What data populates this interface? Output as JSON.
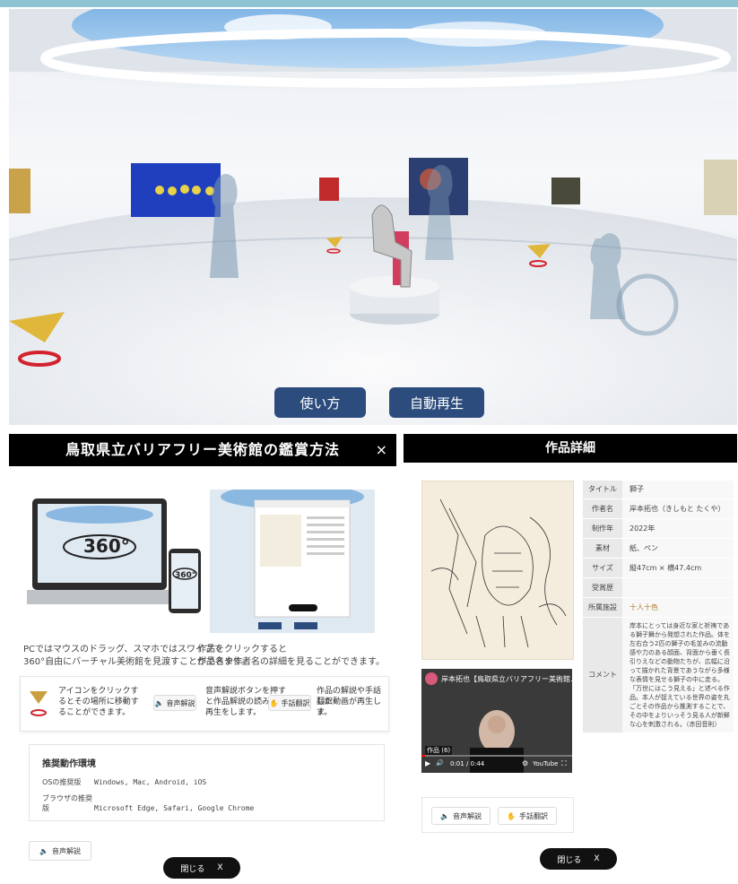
{
  "gallery": {
    "usage_button": "使い方",
    "autoplay_button": "自動再生"
  },
  "guide": {
    "title": "鳥取県立バリアフリー美術館の鑑賞方法",
    "close_icon": "×",
    "caption_left_1": "PCではマウスのドラッグ、スマホではスワイプで",
    "caption_left_2": "360°自由にバーチャル美術館を見渡すことができます。",
    "caption_right_1": "作品をクリックすると",
    "caption_right_2": "作品名や作者名の詳細を見ることができます。",
    "tip1_1": "アイコンをクリックす",
    "tip1_2": "るとその場所に移動す",
    "tip1_3": "ることができます。",
    "audio_label": "音声解説",
    "tip2_1": "音声解説ボタンを押す",
    "tip2_2": "と作品解説の読み上げ",
    "tip2_3": "再生をします。",
    "sign_label": "手話翻訳",
    "tip3_1": "作品の解説や手話翻訳",
    "tip3_2": "した動画が再生しま",
    "tip3_3": "す。",
    "req_title": "推奨動作環境",
    "req_os_label": "OSの推奨版",
    "req_os_value": "Windows, Mac, Android, iOS",
    "req_browser_label": "ブラウザの推奨版",
    "req_browser_value": "Microsoft Edge, Safari, Google Chrome",
    "audio_button": "音声解説",
    "close_button": "閉じる",
    "close_x": "X",
    "video_zoom": "360°"
  },
  "detail": {
    "title": "作品詳細",
    "rows": [
      {
        "key": "タイトル",
        "value": "獅子"
      },
      {
        "key": "作者名",
        "value": "岸本拓也（きしもと たくや）"
      },
      {
        "key": "制作年",
        "value": "2022年"
      },
      {
        "key": "素材",
        "value": "紙、ペン"
      },
      {
        "key": "サイズ",
        "value": "縦47cm × 横47.4cm"
      },
      {
        "key": "受賞歴",
        "value": ""
      },
      {
        "key": "所属施設",
        "value": "十人十色"
      }
    ],
    "comment_key": "コメント",
    "comment_value": "岸本にとっては身近な家と祈祷である獅子舞から発想された作品。体を左右合う2匹の獅子の毛並みの流動感や力のある顔面、背面から垂く長引りえなどの動物たちが、広幅に沿って描かれた背景であうながら多様な表情を見せる獅子の中に走る。「万世にはこう見える」と述べる作品。本人が捉えている世界の姿を丸ごとその作品から推測することで、その中をよりいっそう見る人が新鮮な心を刺激される。（赤田音則）",
    "video_title": "岸本拓也【鳥取県立バリアフリー美術館…",
    "video_time": "0:01 / 0:44",
    "video_badge": "作品 (6)",
    "youtube_label": "YouTube",
    "audio_button": "音声解説",
    "sign_button": "手話翻訳",
    "close_button": "閉じる",
    "close_x": "X"
  }
}
